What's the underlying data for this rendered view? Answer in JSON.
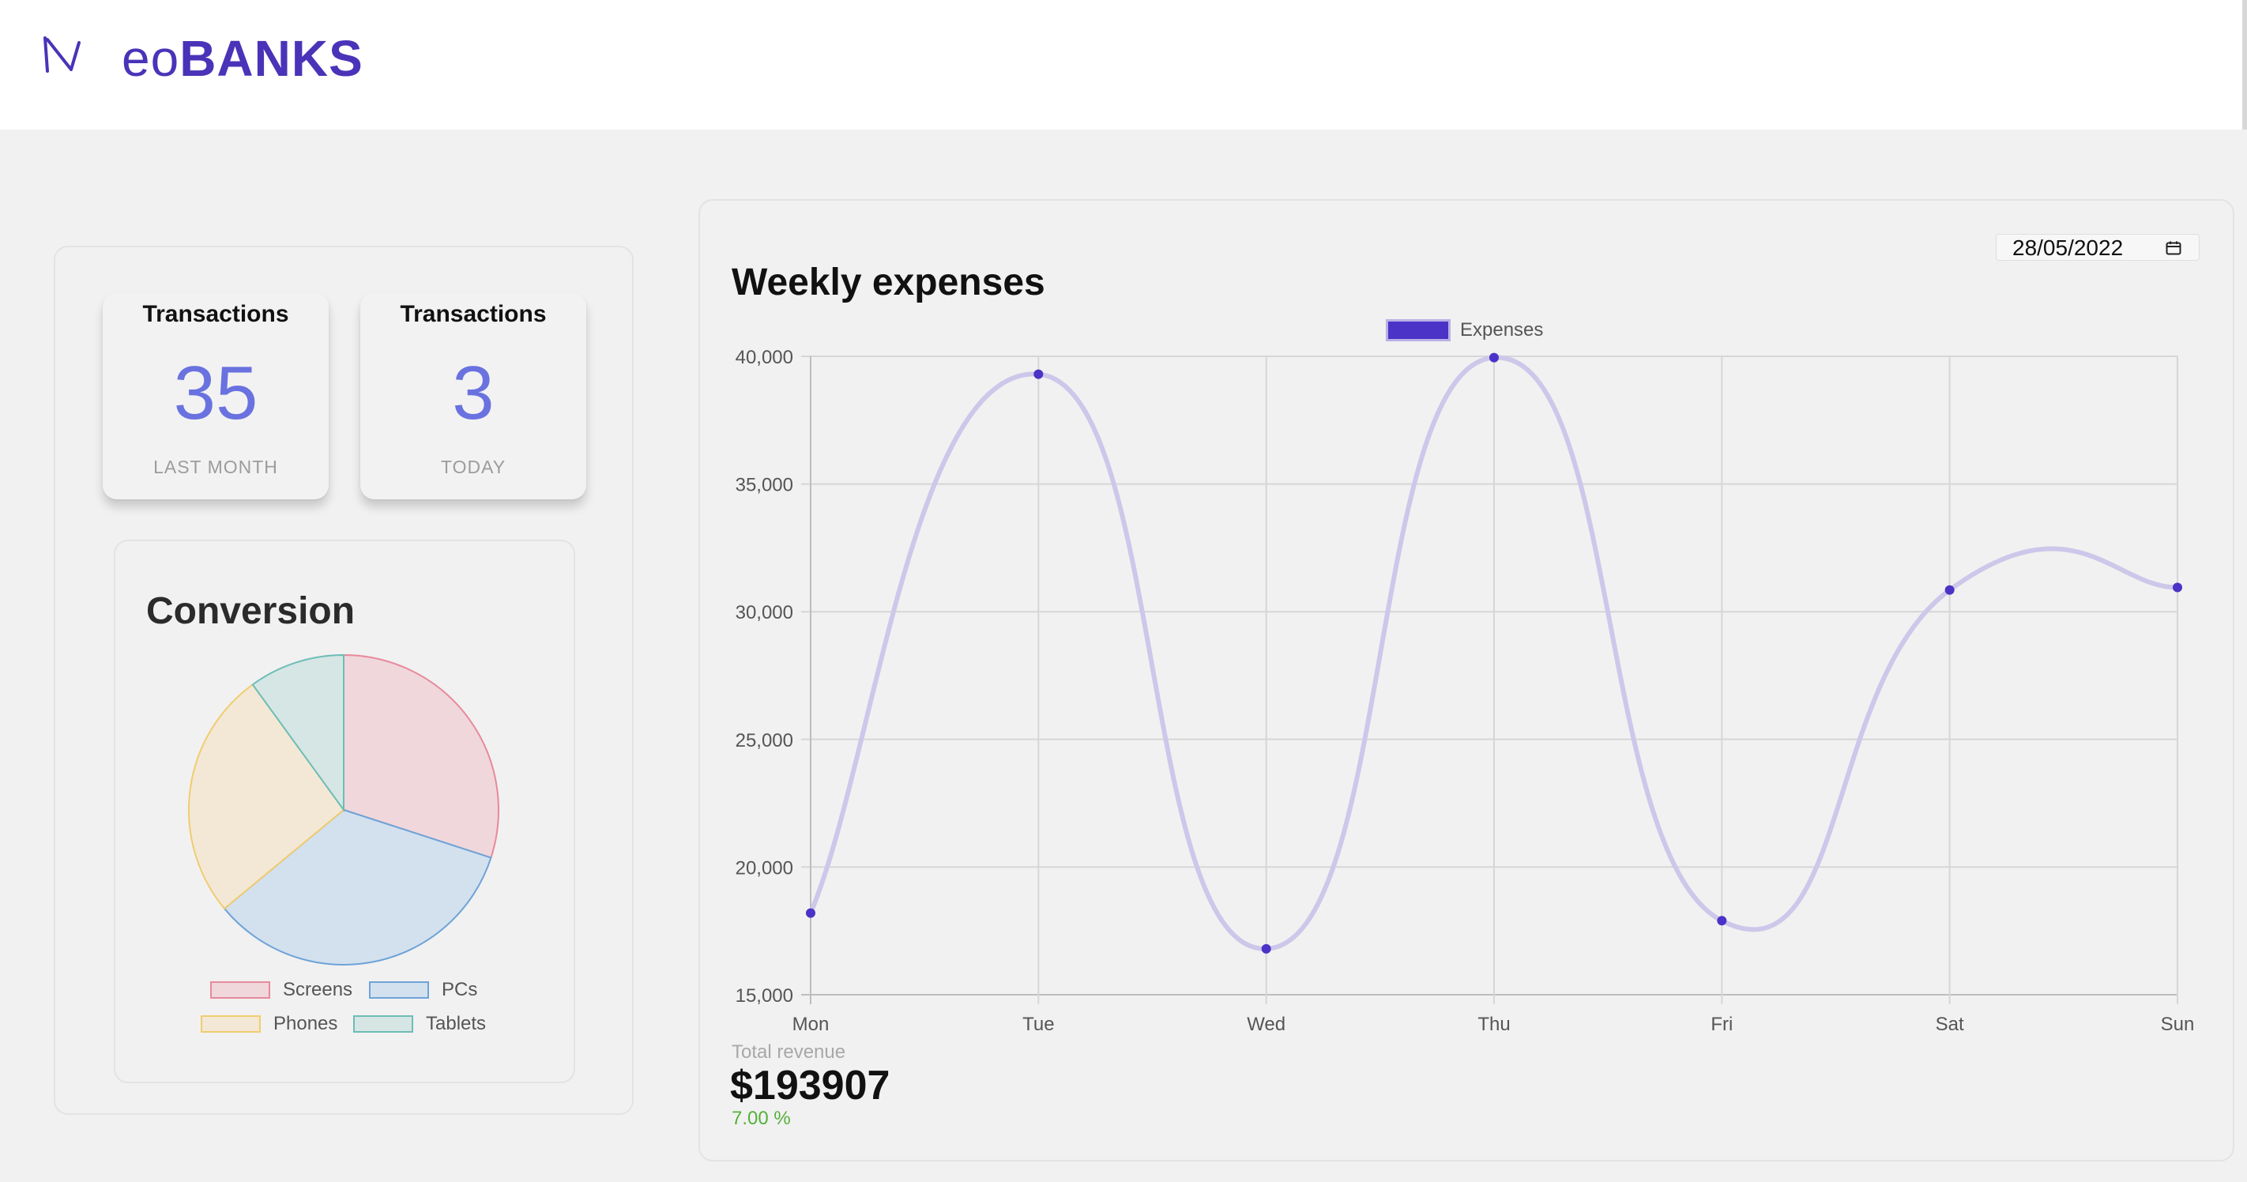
{
  "brand": {
    "name_prefix": "eo",
    "name_suffix": "BANKS",
    "color": "#4a33b8"
  },
  "stats": [
    {
      "title": "Transactions",
      "value": "35",
      "sublabel": "LAST MONTH"
    },
    {
      "title": "Transactions",
      "value": "3",
      "sublabel": "TODAY"
    }
  ],
  "conversion": {
    "title": "Conversion",
    "legend": [
      {
        "label": "Screens",
        "fill": "#efd7dc",
        "stroke": "#e8899a"
      },
      {
        "label": "PCs",
        "fill": "#d3e1ee",
        "stroke": "#6ea3d8"
      },
      {
        "label": "Phones",
        "fill": "#f3e8d6",
        "stroke": "#f1cc6e"
      },
      {
        "label": "Tablets",
        "fill": "#d6e6e5",
        "stroke": "#6dbdb6"
      }
    ]
  },
  "expenses": {
    "title": "Weekly expenses",
    "date_value": "28/05/2022",
    "legend_label": "Expenses",
    "total_label": "Total revenue",
    "total_value": "$193907",
    "change": "7.00 %"
  },
  "chart_data": [
    {
      "type": "line",
      "title": "Weekly expenses",
      "categories": [
        "Mon",
        "Tue",
        "Wed",
        "Thu",
        "Fri",
        "Sat",
        "Sun"
      ],
      "series": [
        {
          "name": "Expenses",
          "values": [
            18200,
            39300,
            16800,
            39950,
            17900,
            30850,
            30950
          ],
          "point_color": "#4a33c6",
          "line_color": "#cdc7ea"
        }
      ],
      "yticks": [
        "40,000",
        "35,000",
        "30,000",
        "25,000",
        "20,000",
        "15,000"
      ],
      "ylim": [
        15000,
        40000
      ],
      "grid": true,
      "legend_position": "top-center"
    },
    {
      "type": "pie",
      "title": "Conversion",
      "categories": [
        "Screens",
        "PCs",
        "Phones",
        "Tablets"
      ],
      "values": [
        30,
        34,
        26,
        10
      ]
    }
  ]
}
